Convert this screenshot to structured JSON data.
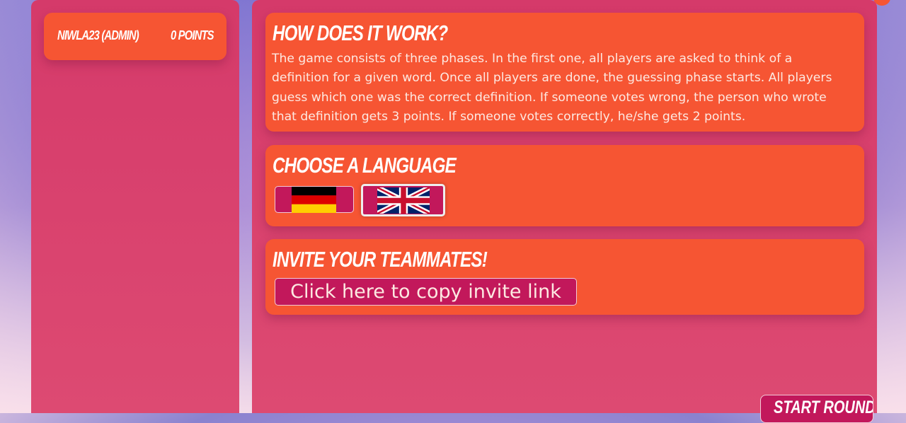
{
  "players": [
    {
      "name": "Niwla23 (Admin)",
      "points": "0 Points"
    }
  ],
  "how_it_works": {
    "title": "How does it work?",
    "text": "The game consists of three phases. In the first one, all players are asked to think of a definition for a given word. Once all players are done, the guessing phase starts. All players guess which one was the correct definition. If someone votes wrong, the person who wrote that definition gets 3 points. If someone votes correctly, he/she gets 2 points."
  },
  "language": {
    "title": "Choose a language",
    "options": [
      {
        "icon": "german-flag-icon",
        "selected": false
      },
      {
        "icon": "uk-flag-icon",
        "selected": true
      }
    ]
  },
  "invite": {
    "title": "Invite your teammates!",
    "button_label": "Click here to copy invite link"
  },
  "start_button_label": "Start round",
  "colors": {
    "card": "#f65533",
    "panel": "#d53a6a",
    "button": "#c2185b"
  }
}
